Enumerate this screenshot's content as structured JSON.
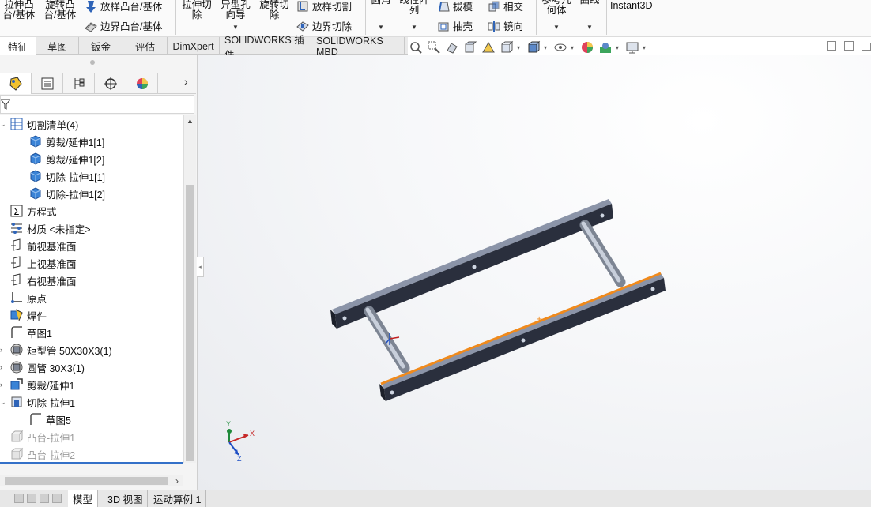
{
  "ribbon": {
    "extrude_boss": "拉伸凸\n台/基体",
    "revolve_boss": "旋转凸\n台/基体",
    "loft_boss": "放样凸台/基体",
    "boundary_boss": "边界凸台/基体",
    "extrude_cut": "拉伸切\n除",
    "hole_wizard": "异型孔\n向导",
    "revolve_cut": "旋转切\n除",
    "loft_cut": "放样切割",
    "boundary_cut": "边界切除",
    "fillet": "圆角",
    "linear_pattern": "线性阵\n列",
    "draft": "拔模",
    "intersect": "相交",
    "shell": "抽壳",
    "mirror": "镜向",
    "ref_geometry": "参考几\n何体",
    "curves": "曲线",
    "instant3d": "Instant3D"
  },
  "tabs": [
    {
      "label": "特征",
      "active": true
    },
    {
      "label": "草图"
    },
    {
      "label": "钣金"
    },
    {
      "label": "评估"
    },
    {
      "label": "DimXpert"
    },
    {
      "label": "SOLIDWORKS 插件"
    },
    {
      "label": "SOLIDWORKS MBD"
    }
  ],
  "tree": {
    "items": [
      {
        "label": "切割清单(4)",
        "icon": "cut-list-icon",
        "indent": 1,
        "toggle": "-"
      },
      {
        "label": "剪裁/延伸1[1]",
        "icon": "solid-body-icon",
        "indent": 2
      },
      {
        "label": "剪裁/延伸1[2]",
        "icon": "solid-body-icon",
        "indent": 2
      },
      {
        "label": "切除-拉伸1[1]",
        "icon": "solid-body-icon",
        "indent": 2
      },
      {
        "label": "切除-拉伸1[2]",
        "icon": "solid-body-icon",
        "indent": 2
      },
      {
        "label": "方程式",
        "icon": "equations-icon",
        "indent": 1
      },
      {
        "label": "材质 <未指定>",
        "icon": "material-icon",
        "indent": 1
      },
      {
        "label": "前视基准面",
        "icon": "plane-icon",
        "indent": 1
      },
      {
        "label": "上视基准面",
        "icon": "plane-icon",
        "indent": 1
      },
      {
        "label": "右视基准面",
        "icon": "plane-icon",
        "indent": 1
      },
      {
        "label": "原点",
        "icon": "origin-icon",
        "indent": 1
      },
      {
        "label": "焊件",
        "icon": "weldment-icon",
        "indent": 1
      },
      {
        "label": "草图1",
        "icon": "sketch-icon",
        "indent": 1
      },
      {
        "label": "矩型管 50X30X3(1)",
        "icon": "structural-member-icon",
        "indent": 1,
        "toggle": "›"
      },
      {
        "label": "圆管 30X3(1)",
        "icon": "structural-member-icon",
        "indent": 1,
        "toggle": "›"
      },
      {
        "label": "剪裁/延伸1",
        "icon": "trim-extend-icon",
        "indent": 1,
        "toggle": "›"
      },
      {
        "label": "切除-拉伸1",
        "icon": "extrude-cut-icon",
        "indent": 1,
        "toggle": "-"
      },
      {
        "label": "草图5",
        "icon": "sketch-icon",
        "indent": 2
      },
      {
        "label": "凸台-拉伸1",
        "icon": "boss-extrude-icon",
        "indent": 1,
        "dim": true
      },
      {
        "label": "凸台-拉伸2",
        "icon": "boss-extrude-icon",
        "indent": 1,
        "dim": true
      }
    ]
  },
  "bottom_tabs": [
    {
      "label": "模型",
      "active": true
    },
    {
      "label": "3D 视图"
    },
    {
      "label": "运动算例 1"
    }
  ],
  "triad": {
    "x": "X",
    "y": "Y",
    "z": "Z"
  },
  "colors": {
    "selection_highlight": "#f08a1c",
    "tube_dark": "#2a2f3d",
    "accent_blue": "#3370c8"
  }
}
